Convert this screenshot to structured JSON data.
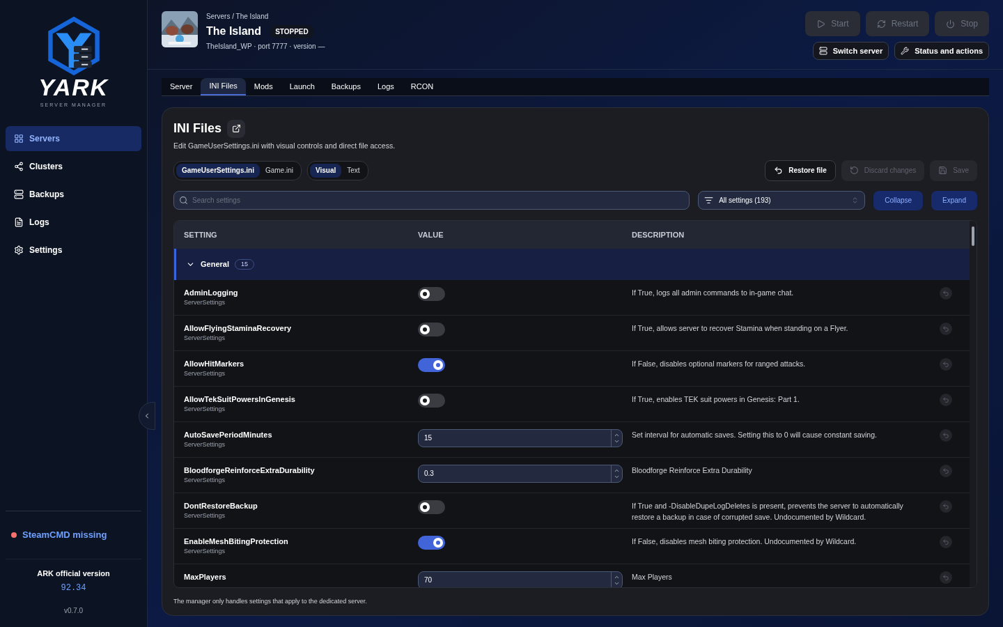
{
  "sidebar": {
    "logo": {
      "wordmark": "YARK",
      "tagline": "SERVER MANAGER"
    },
    "items": [
      {
        "label": "Servers",
        "selected": true
      },
      {
        "label": "Clusters",
        "selected": false
      },
      {
        "label": "Backups",
        "selected": false
      },
      {
        "label": "Logs",
        "selected": false
      },
      {
        "label": "Settings",
        "selected": false
      }
    ],
    "status": {
      "label": "SteamCMD missing",
      "color": "#f87171"
    },
    "version_label": "ARK official version",
    "version_value": "92.34",
    "app_version": "v0.7.0"
  },
  "header": {
    "breadcrumb": "Servers / The Island",
    "title": "The Island",
    "status_badge": "STOPPED",
    "meta": "TheIsland_WP · port 7777 · version —",
    "actions": [
      {
        "label": "Start",
        "disabled": true
      },
      {
        "label": "Restart",
        "disabled": true
      },
      {
        "label": "Stop",
        "disabled": true
      }
    ],
    "links": [
      {
        "label": "Switch server"
      },
      {
        "label": "Status and actions"
      }
    ]
  },
  "tabs": [
    {
      "label": "Server",
      "selected": false
    },
    {
      "label": "INI Files",
      "selected": true
    },
    {
      "label": "Mods",
      "selected": false
    },
    {
      "label": "Launch",
      "selected": false
    },
    {
      "label": "Backups",
      "selected": false
    },
    {
      "label": "Logs",
      "selected": false
    },
    {
      "label": "RCON",
      "selected": false
    }
  ],
  "panel": {
    "title": "INI Files",
    "description": "Edit GameUserSettings.ini with visual controls and direct file access.",
    "files": [
      {
        "label": "GameUserSettings.ini",
        "selected": true
      },
      {
        "label": "Game.ini",
        "selected": false
      }
    ],
    "modes": [
      {
        "label": "Visual",
        "selected": true
      },
      {
        "label": "Text",
        "selected": false
      }
    ],
    "buttons": [
      {
        "label": "Restore file",
        "disabled": false
      },
      {
        "label": "Discard changes",
        "disabled": true
      },
      {
        "label": "Save",
        "disabled": true
      }
    ],
    "search": {
      "placeholder": "Search settings"
    },
    "filter": {
      "value": "All settings (193)"
    },
    "collapse": "Collapse",
    "expand": "Expand",
    "table": {
      "columns": [
        "SETTING",
        "VALUE",
        "DESCRIPTION"
      ],
      "group": {
        "label": "General",
        "count": "15",
        "expanded": true
      },
      "rows": [
        {
          "name": "AdminLogging",
          "section": "ServerSettings",
          "kind": "toggle",
          "on": false,
          "description": "If True, logs all admin commands to in-game chat."
        },
        {
          "name": "AllowFlyingStaminaRecovery",
          "section": "ServerSettings",
          "kind": "toggle",
          "on": false,
          "description": "If True, allows server to recover Stamina when standing on a Flyer."
        },
        {
          "name": "AllowHitMarkers",
          "section": "ServerSettings",
          "kind": "toggle",
          "on": true,
          "description": "If False, disables optional markers for ranged attacks."
        },
        {
          "name": "AllowTekSuitPowersInGenesis",
          "section": "ServerSettings",
          "kind": "toggle",
          "on": false,
          "description": "If True, enables TEK suit powers in Genesis: Part 1."
        },
        {
          "name": "AutoSavePeriodMinutes",
          "section": "ServerSettings",
          "kind": "number",
          "value": "15",
          "description": "Set interval for automatic saves. Setting this to 0 will cause constant saving."
        },
        {
          "name": "BloodforgeReinforceExtraDurability",
          "section": "ServerSettings",
          "kind": "number",
          "value": "0.3",
          "description": "Bloodforge Reinforce Extra Durability"
        },
        {
          "name": "DontRestoreBackup",
          "section": "ServerSettings",
          "kind": "toggle",
          "on": false,
          "description": "If True and -DisableDupeLogDeletes is present, prevents the server to automatically restore a backup in case of corrupted save. Undocumented by Wildcard."
        },
        {
          "name": "EnableMeshBitingProtection",
          "section": "ServerSettings",
          "kind": "toggle",
          "on": true,
          "description": "If False, disables mesh biting protection. Undocumented by Wildcard."
        },
        {
          "name": "MaxPlayers",
          "kind": "number",
          "value": "70",
          "description": "Max Players"
        }
      ]
    },
    "footnote": "The manager only handles settings that apply to the dedicated server."
  }
}
